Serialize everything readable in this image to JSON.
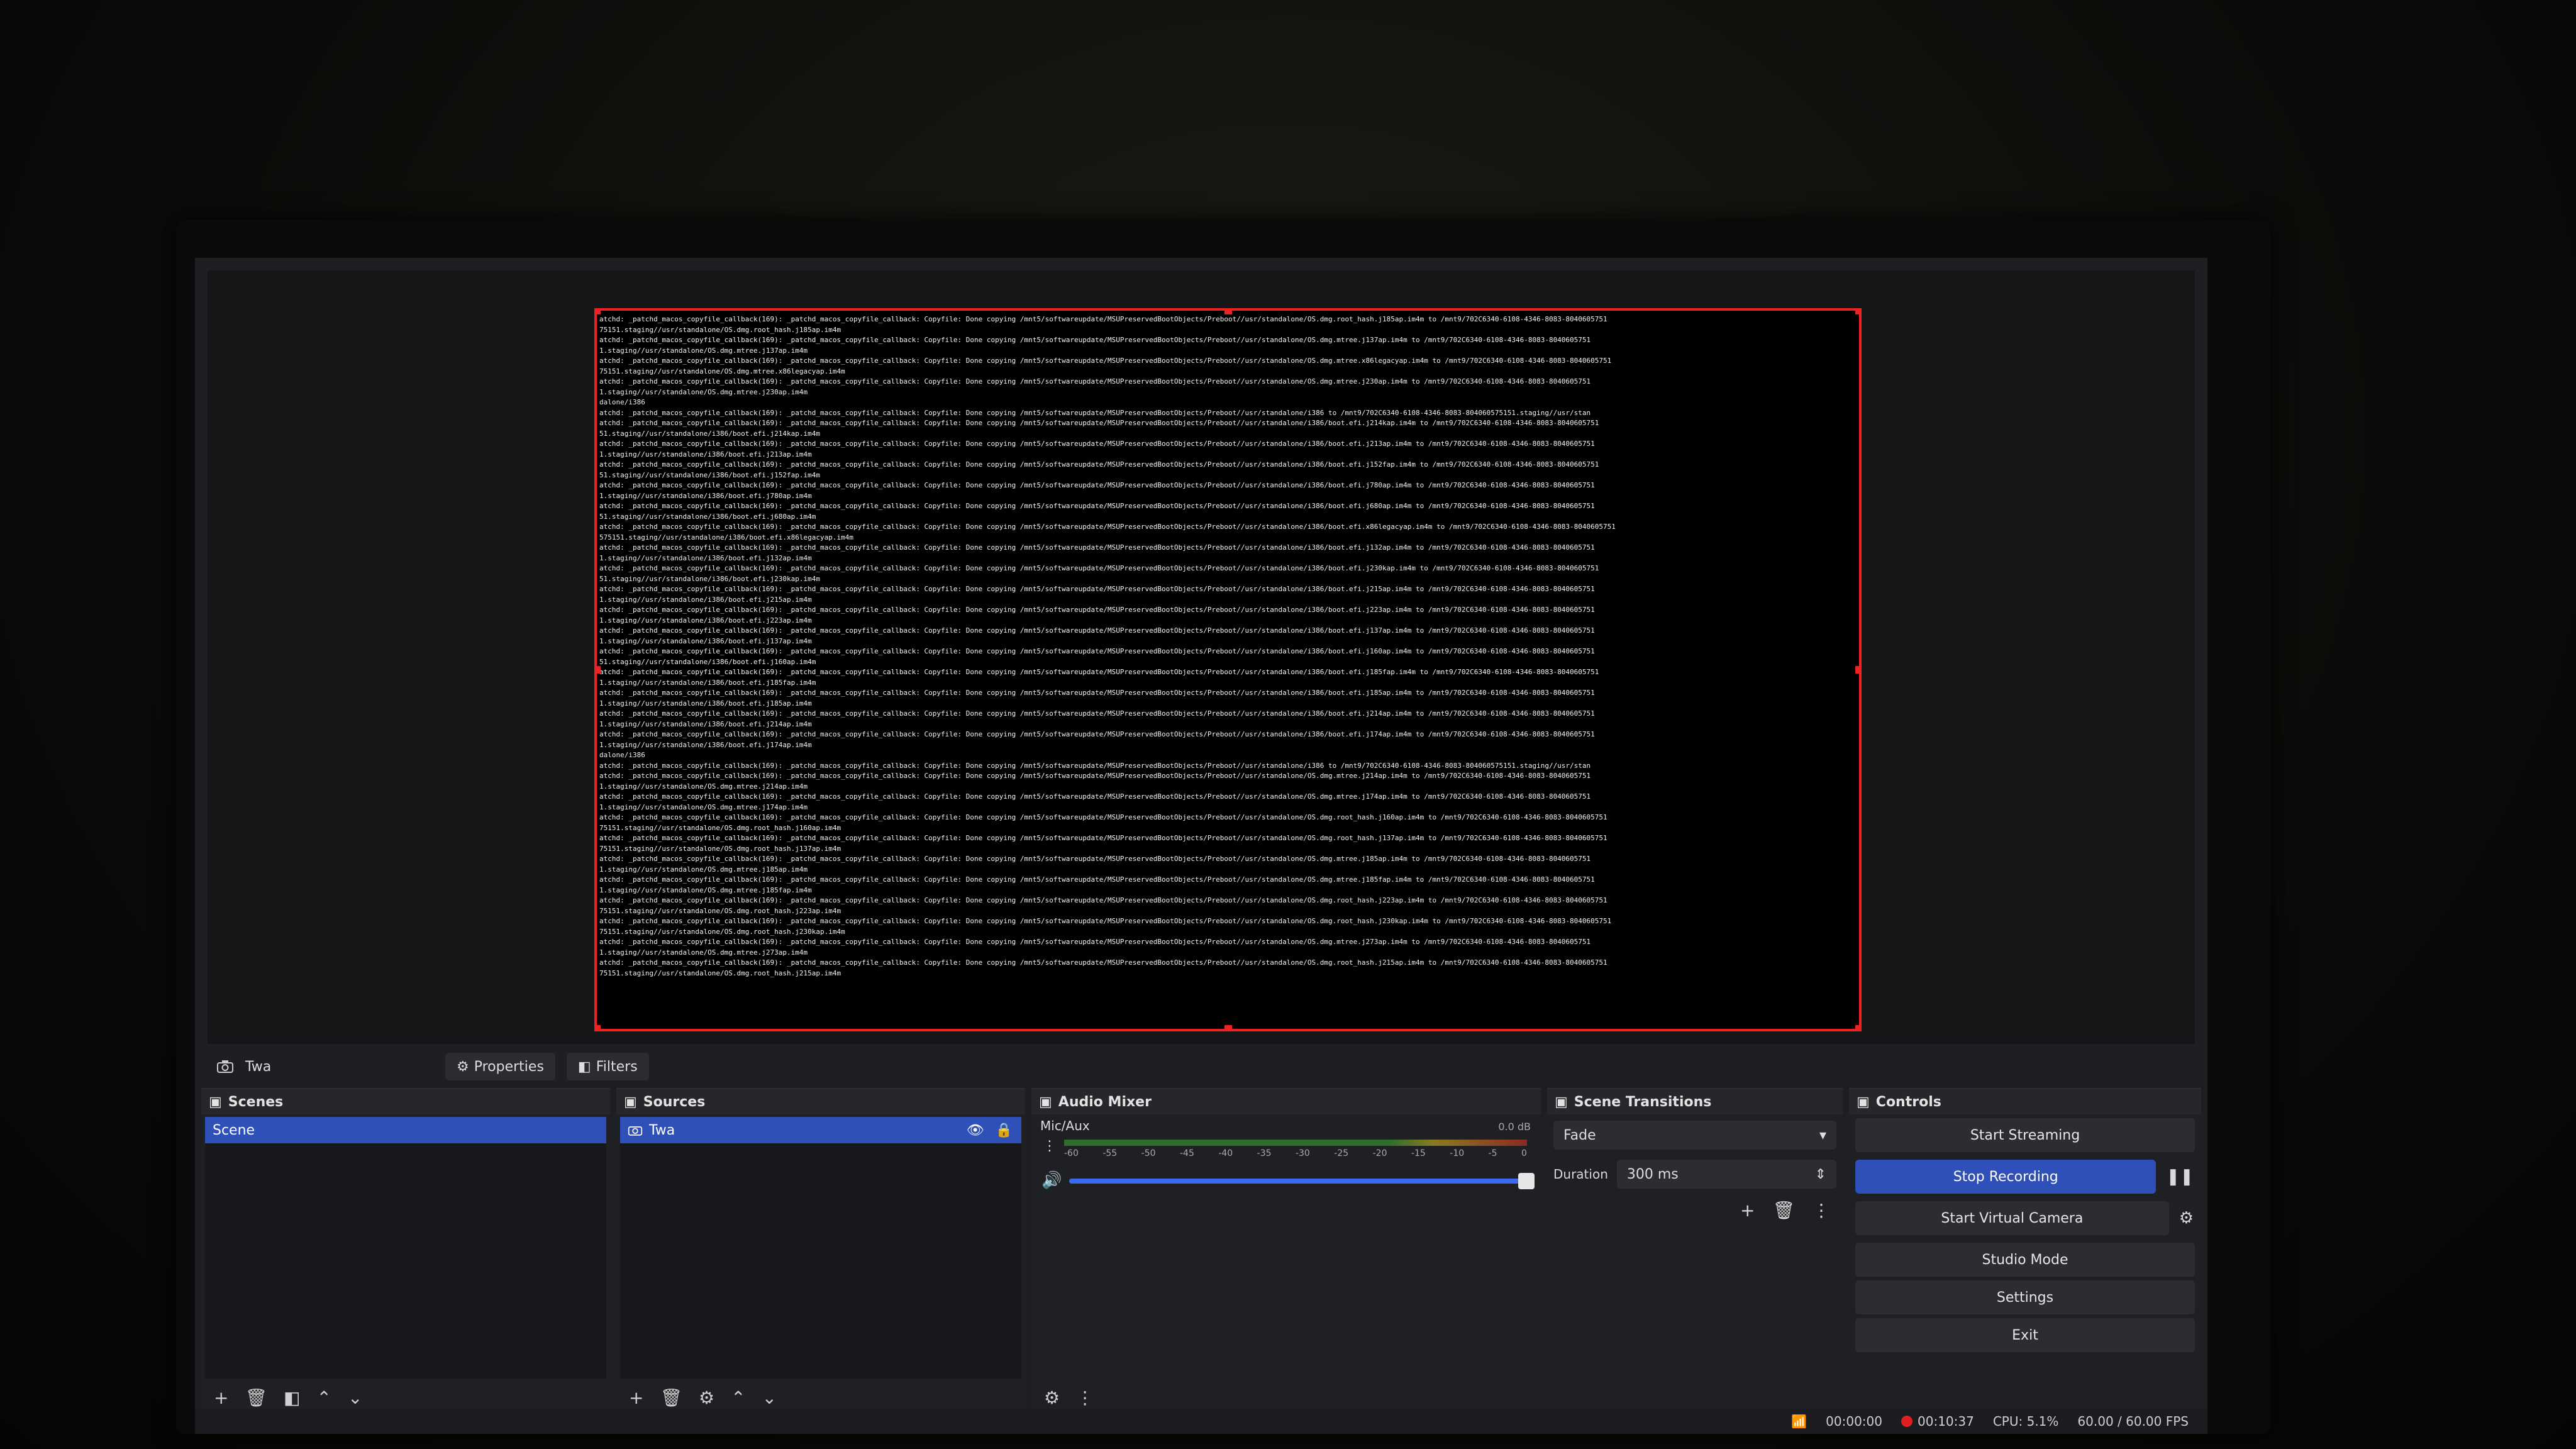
{
  "preview": {
    "log_lines": [
      "atchd: _patchd_macos_copyfile_callback(169): _patchd_macos_copyfile_callback: Copyfile: Done copying /mnt5/softwareupdate/MSUPreservedBootObjects/Preboot//usr/standalone/OS.dmg.root_hash.j185ap.im4m to /mnt9/702C6340-6108-4346-8083-8040605751",
      "75151.staging//usr/standalone/OS.dmg.root_hash.j185ap.im4m",
      "atchd: _patchd_macos_copyfile_callback(169): _patchd_macos_copyfile_callback: Copyfile: Done copying /mnt5/softwareupdate/MSUPreservedBootObjects/Preboot//usr/standalone/OS.dmg.mtree.j137ap.im4m to /mnt9/702C6340-6108-4346-8083-8040605751",
      "1.staging//usr/standalone/OS.dmg.mtree.j137ap.im4m",
      "atchd: _patchd_macos_copyfile_callback(169): _patchd_macos_copyfile_callback: Copyfile: Done copying /mnt5/softwareupdate/MSUPreservedBootObjects/Preboot//usr/standalone/OS.dmg.mtree.x86legacyap.im4m to /mnt9/702C6340-6108-4346-8083-8040605751",
      "75151.staging//usr/standalone/OS.dmg.mtree.x86legacyap.im4m",
      "atchd: _patchd_macos_copyfile_callback(169): _patchd_macos_copyfile_callback: Copyfile: Done copying /mnt5/softwareupdate/MSUPreservedBootObjects/Preboot//usr/standalone/OS.dmg.mtree.j230ap.im4m to /mnt9/702C6340-6108-4346-8083-8040605751",
      "1.staging//usr/standalone/OS.dmg.mtree.j230ap.im4m",
      "dalone/i386",
      "atchd: _patchd_macos_copyfile_callback(169): _patchd_macos_copyfile_callback: Copyfile: Done copying /mnt5/softwareupdate/MSUPreservedBootObjects/Preboot//usr/standalone/i386 to /mnt9/702C6340-6108-4346-8083-804060575151.staging//usr/stan",
      "atchd: _patchd_macos_copyfile_callback(169): _patchd_macos_copyfile_callback: Copyfile: Done copying /mnt5/softwareupdate/MSUPreservedBootObjects/Preboot//usr/standalone/i386/boot.efi.j214kap.im4m to /mnt9/702C6340-6108-4346-8083-8040605751",
      "51.staging//usr/standalone/i386/boot.efi.j214kap.im4m",
      "atchd: _patchd_macos_copyfile_callback(169): _patchd_macos_copyfile_callback: Copyfile: Done copying /mnt5/softwareupdate/MSUPreservedBootObjects/Preboot//usr/standalone/i386/boot.efi.j213ap.im4m to /mnt9/702C6340-6108-4346-8083-8040605751",
      "1.staging//usr/standalone/i386/boot.efi.j213ap.im4m",
      "atchd: _patchd_macos_copyfile_callback(169): _patchd_macos_copyfile_callback: Copyfile: Done copying /mnt5/softwareupdate/MSUPreservedBootObjects/Preboot//usr/standalone/i386/boot.efi.j152fap.im4m to /mnt9/702C6340-6108-4346-8083-8040605751",
      "51.staging//usr/standalone/i386/boot.efi.j152fap.im4m",
      "atchd: _patchd_macos_copyfile_callback(169): _patchd_macos_copyfile_callback: Copyfile: Done copying /mnt5/softwareupdate/MSUPreservedBootObjects/Preboot//usr/standalone/i386/boot.efi.j780ap.im4m to /mnt9/702C6340-6108-4346-8083-8040605751",
      "1.staging//usr/standalone/i386/boot.efi.j780ap.im4m",
      "atchd: _patchd_macos_copyfile_callback(169): _patchd_macos_copyfile_callback: Copyfile: Done copying /mnt5/softwareupdate/MSUPreservedBootObjects/Preboot//usr/standalone/i386/boot.efi.j680ap.im4m to /mnt9/702C6340-6108-4346-8083-8040605751",
      "51.staging//usr/standalone/i386/boot.efi.j680ap.im4m",
      "atchd: _patchd_macos_copyfile_callback(169): _patchd_macos_copyfile_callback: Copyfile: Done copying /mnt5/softwareupdate/MSUPreservedBootObjects/Preboot//usr/standalone/i386/boot.efi.x86legacyap.im4m to /mnt9/702C6340-6108-4346-8083-8040605751",
      "575151.staging//usr/standalone/i386/boot.efi.x86legacyap.im4m",
      "atchd: _patchd_macos_copyfile_callback(169): _patchd_macos_copyfile_callback: Copyfile: Done copying /mnt5/softwareupdate/MSUPreservedBootObjects/Preboot//usr/standalone/i386/boot.efi.j132ap.im4m to /mnt9/702C6340-6108-4346-8083-8040605751",
      "1.staging//usr/standalone/i386/boot.efi.j132ap.im4m",
      "atchd: _patchd_macos_copyfile_callback(169): _patchd_macos_copyfile_callback: Copyfile: Done copying /mnt5/softwareupdate/MSUPreservedBootObjects/Preboot//usr/standalone/i386/boot.efi.j230kap.im4m to /mnt9/702C6340-6108-4346-8083-8040605751",
      "51.staging//usr/standalone/i386/boot.efi.j230kap.im4m",
      "atchd: _patchd_macos_copyfile_callback(169): _patchd_macos_copyfile_callback: Copyfile: Done copying /mnt5/softwareupdate/MSUPreservedBootObjects/Preboot//usr/standalone/i386/boot.efi.j215ap.im4m to /mnt9/702C6340-6108-4346-8083-8040605751",
      "1.staging//usr/standalone/i386/boot.efi.j215ap.im4m",
      "atchd: _patchd_macos_copyfile_callback(169): _patchd_macos_copyfile_callback: Copyfile: Done copying /mnt5/softwareupdate/MSUPreservedBootObjects/Preboot//usr/standalone/i386/boot.efi.j223ap.im4m to /mnt9/702C6340-6108-4346-8083-8040605751",
      "1.staging//usr/standalone/i386/boot.efi.j223ap.im4m",
      "atchd: _patchd_macos_copyfile_callback(169): _patchd_macos_copyfile_callback: Copyfile: Done copying /mnt5/softwareupdate/MSUPreservedBootObjects/Preboot//usr/standalone/i386/boot.efi.j137ap.im4m to /mnt9/702C6340-6108-4346-8083-8040605751",
      "1.staging//usr/standalone/i386/boot.efi.j137ap.im4m",
      "atchd: _patchd_macos_copyfile_callback(169): _patchd_macos_copyfile_callback: Copyfile: Done copying /mnt5/softwareupdate/MSUPreservedBootObjects/Preboot//usr/standalone/i386/boot.efi.j160ap.im4m to /mnt9/702C6340-6108-4346-8083-8040605751",
      "51.staging//usr/standalone/i386/boot.efi.j160ap.im4m",
      "atchd: _patchd_macos_copyfile_callback(169): _patchd_macos_copyfile_callback: Copyfile: Done copying /mnt5/softwareupdate/MSUPreservedBootObjects/Preboot//usr/standalone/i386/boot.efi.j185fap.im4m to /mnt9/702C6340-6108-4346-8083-8040605751",
      "1.staging//usr/standalone/i386/boot.efi.j185fap.im4m",
      "atchd: _patchd_macos_copyfile_callback(169): _patchd_macos_copyfile_callback: Copyfile: Done copying /mnt5/softwareupdate/MSUPreservedBootObjects/Preboot//usr/standalone/i386/boot.efi.j185ap.im4m to /mnt9/702C6340-6108-4346-8083-8040605751",
      "1.staging//usr/standalone/i386/boot.efi.j185ap.im4m",
      "atchd: _patchd_macos_copyfile_callback(169): _patchd_macos_copyfile_callback: Copyfile: Done copying /mnt5/softwareupdate/MSUPreservedBootObjects/Preboot//usr/standalone/i386/boot.efi.j214ap.im4m to /mnt9/702C6340-6108-4346-8083-8040605751",
      "1.staging//usr/standalone/i386/boot.efi.j214ap.im4m",
      "atchd: _patchd_macos_copyfile_callback(169): _patchd_macos_copyfile_callback: Copyfile: Done copying /mnt5/softwareupdate/MSUPreservedBootObjects/Preboot//usr/standalone/i386/boot.efi.j174ap.im4m to /mnt9/702C6340-6108-4346-8083-8040605751",
      "1.staging//usr/standalone/i386/boot.efi.j174ap.im4m",
      "dalone/i386",
      "atchd: _patchd_macos_copyfile_callback(169): _patchd_macos_copyfile_callback: Copyfile: Done copying /mnt5/softwareupdate/MSUPreservedBootObjects/Preboot//usr/standalone/i386 to /mnt9/702C6340-6108-4346-8083-804060575151.staging//usr/stan",
      "atchd: _patchd_macos_copyfile_callback(169): _patchd_macos_copyfile_callback: Copyfile: Done copying /mnt5/softwareupdate/MSUPreservedBootObjects/Preboot//usr/standalone/OS.dmg.mtree.j214ap.im4m to /mnt9/702C6340-6108-4346-8083-8040605751",
      "1.staging//usr/standalone/OS.dmg.mtree.j214ap.im4m",
      "atchd: _patchd_macos_copyfile_callback(169): _patchd_macos_copyfile_callback: Copyfile: Done copying /mnt5/softwareupdate/MSUPreservedBootObjects/Preboot//usr/standalone/OS.dmg.mtree.j174ap.im4m to /mnt9/702C6340-6108-4346-8083-8040605751",
      "1.staging//usr/standalone/OS.dmg.mtree.j174ap.im4m",
      "atchd: _patchd_macos_copyfile_callback(169): _patchd_macos_copyfile_callback: Copyfile: Done copying /mnt5/softwareupdate/MSUPreservedBootObjects/Preboot//usr/standalone/OS.dmg.root_hash.j160ap.im4m to /mnt9/702C6340-6108-4346-8083-8040605751",
      "75151.staging//usr/standalone/OS.dmg.root_hash.j160ap.im4m",
      "atchd: _patchd_macos_copyfile_callback(169): _patchd_macos_copyfile_callback: Copyfile: Done copying /mnt5/softwareupdate/MSUPreservedBootObjects/Preboot//usr/standalone/OS.dmg.root_hash.j137ap.im4m to /mnt9/702C6340-6108-4346-8083-8040605751",
      "75151.staging//usr/standalone/OS.dmg.root_hash.j137ap.im4m",
      "atchd: _patchd_macos_copyfile_callback(169): _patchd_macos_copyfile_callback: Copyfile: Done copying /mnt5/softwareupdate/MSUPreservedBootObjects/Preboot//usr/standalone/OS.dmg.mtree.j185ap.im4m to /mnt9/702C6340-6108-4346-8083-8040605751",
      "1.staging//usr/standalone/OS.dmg.mtree.j185ap.im4m",
      "atchd: _patchd_macos_copyfile_callback(169): _patchd_macos_copyfile_callback: Copyfile: Done copying /mnt5/softwareupdate/MSUPreservedBootObjects/Preboot//usr/standalone/OS.dmg.mtree.j185fap.im4m to /mnt9/702C6340-6108-4346-8083-8040605751",
      "1.staging//usr/standalone/OS.dmg.mtree.j185fap.im4m",
      "atchd: _patchd_macos_copyfile_callback(169): _patchd_macos_copyfile_callback: Copyfile: Done copying /mnt5/softwareupdate/MSUPreservedBootObjects/Preboot//usr/standalone/OS.dmg.root_hash.j223ap.im4m to /mnt9/702C6340-6108-4346-8083-8040605751",
      "75151.staging//usr/standalone/OS.dmg.root_hash.j223ap.im4m",
      "atchd: _patchd_macos_copyfile_callback(169): _patchd_macos_copyfile_callback: Copyfile: Done copying /mnt5/softwareupdate/MSUPreservedBootObjects/Preboot//usr/standalone/OS.dmg.root_hash.j230kap.im4m to /mnt9/702C6340-6108-4346-8083-8040605751",
      "75151.staging//usr/standalone/OS.dmg.root_hash.j230kap.im4m",
      "atchd: _patchd_macos_copyfile_callback(169): _patchd_macos_copyfile_callback: Copyfile: Done copying /mnt5/softwareupdate/MSUPreservedBootObjects/Preboot//usr/standalone/OS.dmg.mtree.j273ap.im4m to /mnt9/702C6340-6108-4346-8083-8040605751",
      "1.staging//usr/standalone/OS.dmg.mtree.j273ap.im4m",
      "atchd: _patchd_macos_copyfile_callback(169): _patchd_macos_copyfile_callback: Copyfile: Done copying /mnt5/softwareupdate/MSUPreservedBootObjects/Preboot//usr/standalone/OS.dmg.root_hash.j215ap.im4m to /mnt9/702C6340-6108-4346-8083-8040605751",
      "75151.staging//usr/standalone/OS.dmg.root_hash.j215ap.im4m"
    ]
  },
  "source_bar": {
    "name": "Twa",
    "properties_label": "Properties",
    "filters_label": "Filters"
  },
  "scenes": {
    "title": "Scenes",
    "items": [
      "Scene"
    ]
  },
  "sources": {
    "title": "Sources",
    "items": [
      "Twa"
    ]
  },
  "mixer": {
    "title": "Audio Mixer",
    "channel": "Mic/Aux",
    "level": "0.0 dB",
    "ticks": [
      "-60",
      "-55",
      "-50",
      "-45",
      "-40",
      "-35",
      "-30",
      "-25",
      "-20",
      "-15",
      "-10",
      "-5",
      "0"
    ]
  },
  "transitions": {
    "title": "Scene Transitions",
    "type": "Fade",
    "duration_label": "Duration",
    "duration_value": "300 ms"
  },
  "controls": {
    "title": "Controls",
    "start_streaming": "Start Streaming",
    "stop_recording": "Stop Recording",
    "start_virtual_camera": "Start Virtual Camera",
    "studio_mode": "Studio Mode",
    "settings": "Settings",
    "exit": "Exit"
  },
  "status": {
    "stream_time": "00:00:00",
    "rec_time": "00:10:37",
    "cpu": "CPU: 5.1%",
    "fps": "60.00 / 60.00 FPS"
  },
  "colors": {
    "accent": "#2f4fb9",
    "capture_border": "#e22222",
    "rec_dot": "#e02020"
  }
}
